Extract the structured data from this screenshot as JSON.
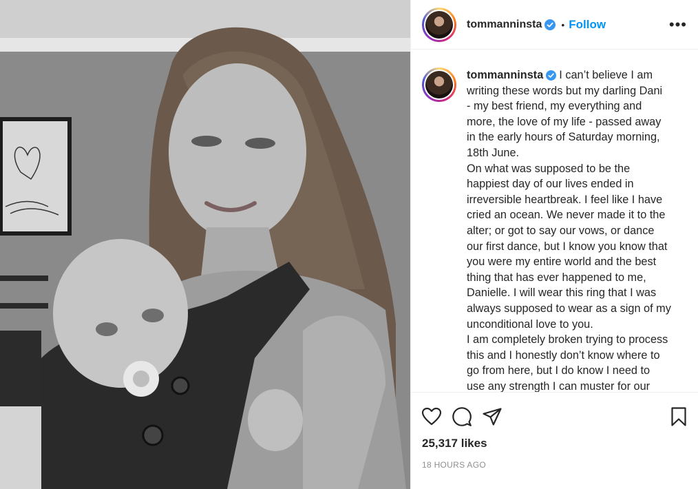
{
  "post": {
    "username": "tommanninsta",
    "follow_label": "Follow",
    "separator": "•",
    "more_label": "•••",
    "caption_lines": [
      "I can’t believe I am",
      "writing these words but my darling Dani",
      "- my best friend, my everything and",
      "more, the love of my life - passed away",
      "in the early hours of Saturday morning,",
      "18th June.",
      "On what was supposed to be the",
      "happiest day of our lives ended in",
      "irreversible heartbreak. I feel like I have",
      "cried an ocean. We never made it to the",
      "alter; or got to say our vows, or dance",
      "our first dance, but I know you know that",
      "you were my entire world and the best",
      "thing that has ever happened to me,",
      "Danielle. I will wear this ring that I was",
      "always supposed to wear as a sign of my",
      "unconditional love to you.",
      "I am completely broken trying to process",
      "this and I honestly don’t know where to",
      "go from here, but I do know I need to",
      "use any strength I can muster for our"
    ],
    "likes": "25,317 likes",
    "timestamp": "18 HOURS AGO"
  },
  "colors": {
    "accent": "#0095f6",
    "text": "#262626",
    "muted": "#8e8e8e",
    "verified": "#3897f0"
  },
  "icons": [
    "verified-badge-icon",
    "more-options-icon",
    "heart-icon",
    "comment-icon",
    "share-icon",
    "bookmark-icon"
  ]
}
